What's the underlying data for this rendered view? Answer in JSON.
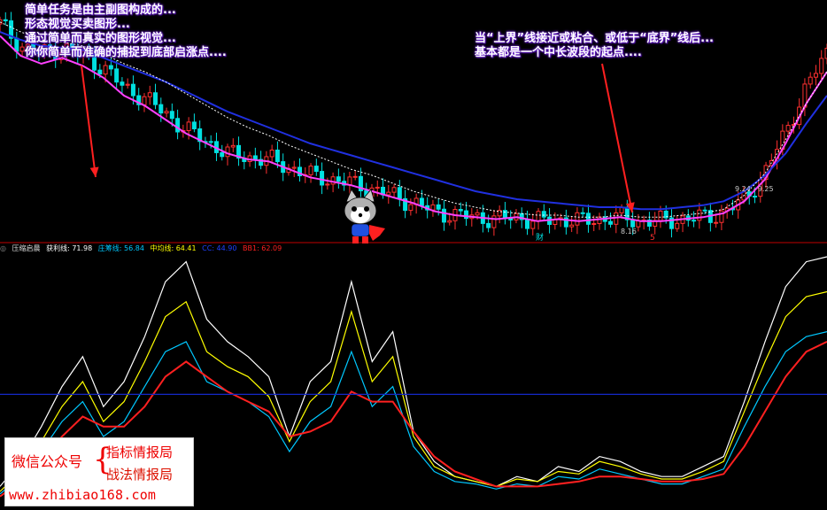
{
  "annotations": {
    "left": [
      "简单任务是由主副图构成的...",
      "形态视觉买卖图形...",
      "通过简单而真实的图形视觉...",
      "你你简单而准确的捕捉到底部启涨点...."
    ],
    "right": [
      "当“上界”线接近或粘合、或低于“底界”线后...",
      "基本都是一个中长波段的起点...."
    ]
  },
  "sub_legend": {
    "name": "压缩启晨",
    "items": [
      {
        "label": "获利线: 71.98",
        "color": "#ffffff"
      },
      {
        "label": "庄筹线: 56.84",
        "color": "#00c8ff"
      },
      {
        "label": "中均线: 64.41",
        "color": "#ffff00"
      },
      {
        "label": "CC: 44.90",
        "color": "#2040ff"
      },
      {
        "label": "BB1: 62.09",
        "color": "#ff2020"
      }
    ]
  },
  "markers": {
    "cai": "财",
    "five": "5",
    "price_low": "8.16",
    "date_range": "9.24 - 9.25"
  },
  "watermark": {
    "left": "微信公众号",
    "brace": "{",
    "r1": "指标情报局",
    "r2": "战法情报局",
    "url": "www.zhibiao168.com"
  },
  "colors": {
    "up": "#ff3030",
    "down": "#00e0e0",
    "upper": "#ff40ff",
    "lower": "#2030e0",
    "mid": "#ffffff",
    "arrow": "#ff2020",
    "divider": "#c00000",
    "hline": "#1428c8"
  },
  "chart_data": [
    {
      "type": "line",
      "title": "",
      "x": [
        0,
        1,
        2,
        3,
        4,
        5,
        6,
        7,
        8,
        9,
        10,
        11,
        12,
        13,
        14,
        15,
        16,
        17,
        18,
        19,
        20,
        21,
        22,
        23,
        24,
        25,
        26,
        27,
        28,
        29,
        30,
        31,
        32,
        33,
        34,
        35,
        36,
        37,
        38,
        39,
        40
      ],
      "series": [
        {
          "name": "",
          "values": [
            112,
            101,
            97,
            100,
            96,
            89,
            78,
            73,
            64,
            55,
            49,
            43,
            41,
            40,
            36,
            32,
            30,
            28,
            25,
            22,
            17,
            13,
            11,
            10,
            9,
            10,
            8,
            9,
            8,
            9,
            10,
            8,
            8,
            9,
            10,
            12,
            20,
            35,
            58,
            82,
            100
          ]
        },
        {
          "name": "",
          "values": [
            108,
            97,
            93,
            96,
            92,
            86,
            76,
            71,
            63,
            55,
            49,
            43,
            41,
            40,
            36,
            32,
            30,
            28,
            25,
            22,
            18,
            14,
            12,
            11,
            10,
            11,
            9,
            10,
            9,
            10,
            11,
            9,
            9,
            10,
            11,
            13,
            20,
            33,
            54,
            76,
            94
          ]
        },
        {
          "name": "",
          "values": [
            102,
            92,
            88,
            91,
            87,
            81,
            72,
            67,
            60,
            53,
            48,
            43,
            40,
            39,
            35,
            31,
            29,
            27,
            24,
            21,
            18,
            14,
            12,
            11,
            10,
            11,
            9,
            10,
            9,
            10,
            11,
            9,
            9,
            10,
            11,
            13,
            19,
            30,
            48,
            68,
            84
          ]
        },
        {
          "name": "",
          "values": [
            104,
            100,
            97,
            96,
            95,
            91,
            87,
            83,
            79,
            74,
            69,
            64,
            60,
            56,
            52,
            48,
            45,
            42,
            39,
            36,
            33,
            30,
            27,
            24,
            22,
            20,
            19,
            18,
            17,
            16,
            16,
            15,
            15,
            16,
            17,
            19,
            24,
            32,
            43,
            58,
            72
          ]
        },
        {
          "name": "",
          "values": [
            109,
            104,
            100,
            99,
            97,
            93,
            88,
            84,
            79,
            73,
            67,
            61,
            56,
            52,
            47,
            43,
            39,
            35,
            32,
            28,
            24,
            21,
            18,
            16,
            14,
            13,
            12,
            12,
            11,
            11,
            12,
            11,
            11,
            12,
            13,
            15,
            22,
            33,
            50,
            68,
            84
          ]
        }
      ]
    },
    {
      "type": "line",
      "x": [
        0,
        1,
        2,
        3,
        4,
        5,
        6,
        7,
        8,
        9,
        10,
        11,
        12,
        13,
        14,
        15,
        16,
        17,
        18,
        19,
        20,
        21,
        22,
        23,
        24,
        25,
        26,
        27,
        28,
        29,
        30,
        31,
        32,
        33,
        34,
        35,
        36,
        37,
        38,
        39,
        40
      ],
      "series": [
        {
          "name": "获利线",
          "values": [
            8,
            18,
            32,
            48,
            60,
            40,
            50,
            68,
            90,
            98,
            75,
            66,
            60,
            52,
            28,
            50,
            58,
            90,
            58,
            70,
            30,
            18,
            12,
            10,
            8,
            12,
            10,
            16,
            14,
            20,
            18,
            14,
            12,
            12,
            16,
            20,
            42,
            66,
            88,
            98,
            100
          ]
        },
        {
          "name": "中均线",
          "values": [
            6,
            14,
            26,
            40,
            50,
            34,
            42,
            58,
            76,
            82,
            62,
            56,
            52,
            44,
            26,
            42,
            50,
            78,
            50,
            60,
            28,
            16,
            12,
            10,
            8,
            11,
            10,
            14,
            13,
            18,
            16,
            13,
            11,
            11,
            14,
            18,
            38,
            58,
            76,
            84,
            86
          ]
        },
        {
          "name": "庄筹线",
          "values": [
            5,
            12,
            22,
            34,
            42,
            28,
            34,
            48,
            62,
            66,
            50,
            46,
            42,
            36,
            22,
            34,
            40,
            62,
            40,
            48,
            24,
            14,
            10,
            9,
            7,
            9,
            8,
            12,
            11,
            15,
            13,
            11,
            9,
            9,
            12,
            15,
            32,
            48,
            62,
            68,
            70
          ]
        },
        {
          "name": "BB1",
          "values": [
            4,
            10,
            18,
            28,
            36,
            32,
            32,
            40,
            52,
            58,
            52,
            46,
            42,
            38,
            28,
            30,
            34,
            46,
            42,
            42,
            30,
            20,
            14,
            11,
            8,
            8,
            8,
            9,
            10,
            12,
            12,
            11,
            10,
            10,
            11,
            13,
            24,
            38,
            52,
            62,
            66
          ]
        },
        {
          "name": "CC",
          "values": [
            44.9,
            44.9,
            44.9,
            44.9,
            44.9,
            44.9,
            44.9,
            44.9,
            44.9,
            44.9,
            44.9,
            44.9,
            44.9,
            44.9,
            44.9,
            44.9,
            44.9,
            44.9,
            44.9,
            44.9,
            44.9,
            44.9,
            44.9,
            44.9,
            44.9,
            44.9,
            44.9,
            44.9,
            44.9,
            44.9,
            44.9,
            44.9,
            44.9,
            44.9,
            44.9,
            44.9,
            44.9,
            44.9,
            44.9,
            44.9,
            44.9
          ]
        }
      ]
    }
  ]
}
